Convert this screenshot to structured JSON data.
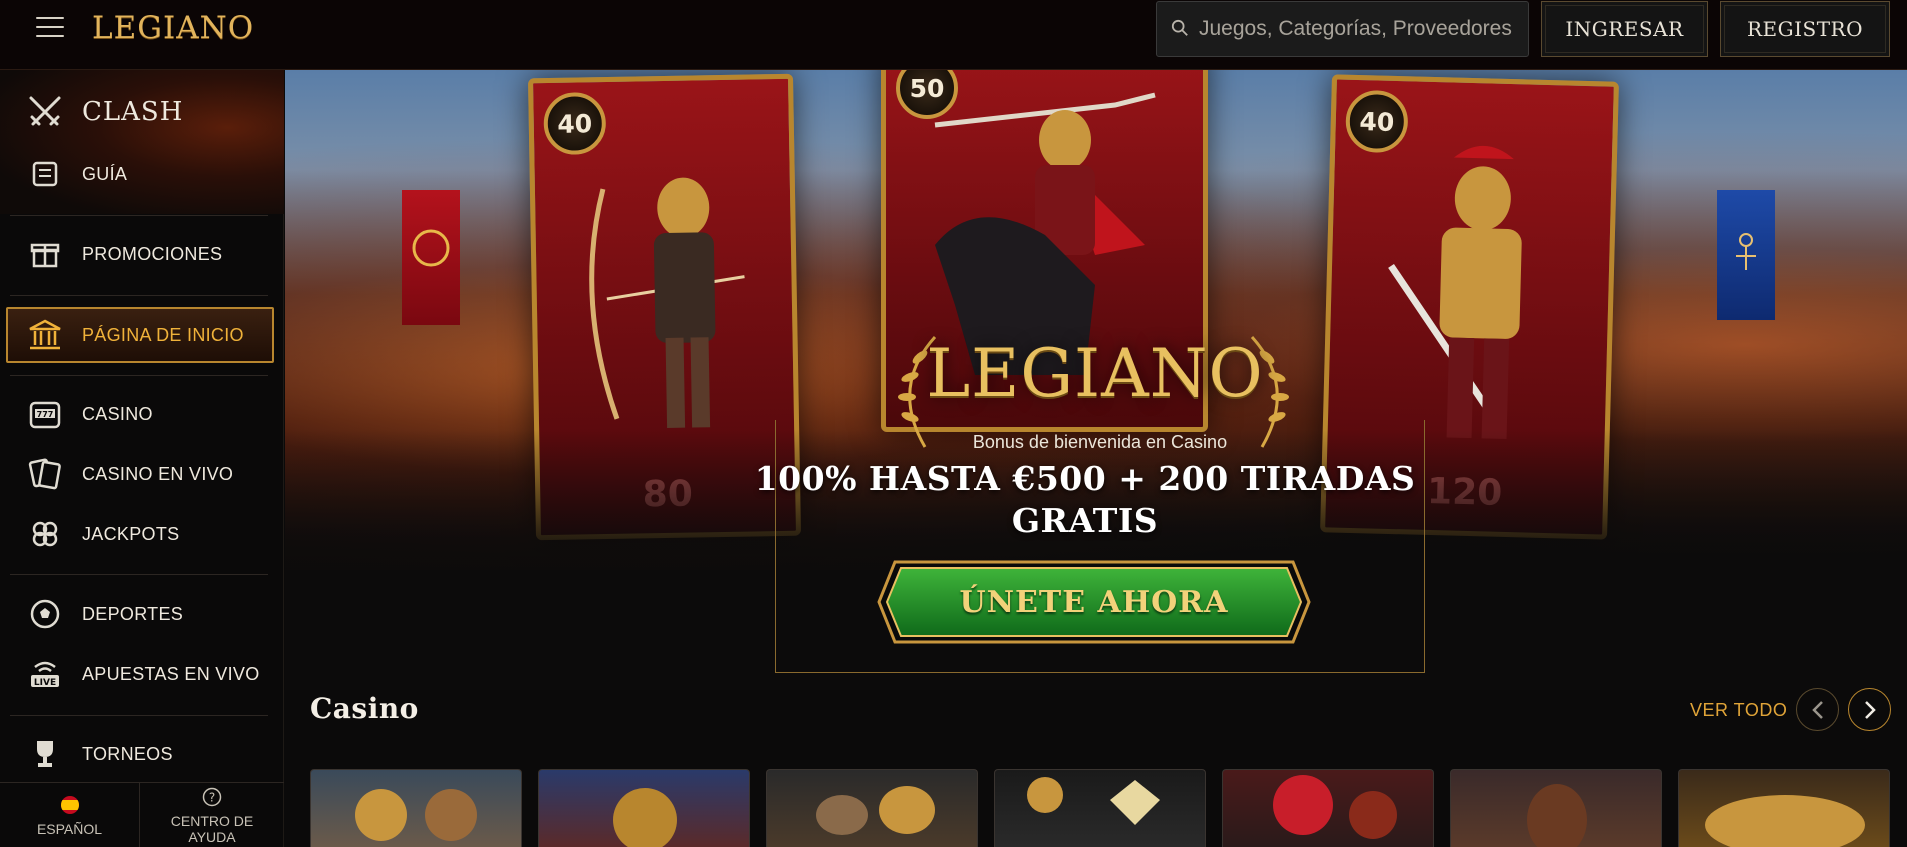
{
  "header": {
    "logo": "LEGIANO",
    "search_placeholder": "Juegos, Categorías, Proveedores",
    "login_label": "INGRESAR",
    "register_label": "REGISTRO"
  },
  "sidebar": {
    "items": [
      {
        "label": "CLASH",
        "icon": "swords-icon"
      },
      {
        "label": "GUÍA",
        "icon": "scroll-icon"
      },
      {
        "label": "PROMOCIONES",
        "icon": "gift-icon"
      },
      {
        "label": "PÁGINA DE INICIO",
        "icon": "temple-icon",
        "active": true
      },
      {
        "label": "CASINO",
        "icon": "slot-machine-icon"
      },
      {
        "label": "CASINO EN VIVO",
        "icon": "cards-icon"
      },
      {
        "label": "JACKPOTS",
        "icon": "clover-icon"
      },
      {
        "label": "DEPORTES",
        "icon": "soccer-ball-icon"
      },
      {
        "label": "APUESTAS EN VIVO",
        "icon": "live-icon"
      },
      {
        "label": "TORNEOS",
        "icon": "trophy-icon"
      }
    ],
    "language": "ESPAÑOL",
    "help": "CENTRO DE AYUDA"
  },
  "hero": {
    "cards": [
      {
        "badge": "40",
        "value": "80"
      },
      {
        "badge": "50"
      },
      {
        "badge": "40",
        "value": "120"
      }
    ],
    "logo": "LEGIANO",
    "subtitle": "Bonus de bienvenida en Casino",
    "offer": "100% HASTA €500 + 200 TIRADAS GRATIS",
    "cta": "ÚNETE AHORA"
  },
  "casino": {
    "title": "Casino",
    "see_all": "VER TODO"
  },
  "colors": {
    "accent_gold": "#e0a438",
    "cta_green": "#1f8a2a",
    "card_red": "#9a1418"
  }
}
